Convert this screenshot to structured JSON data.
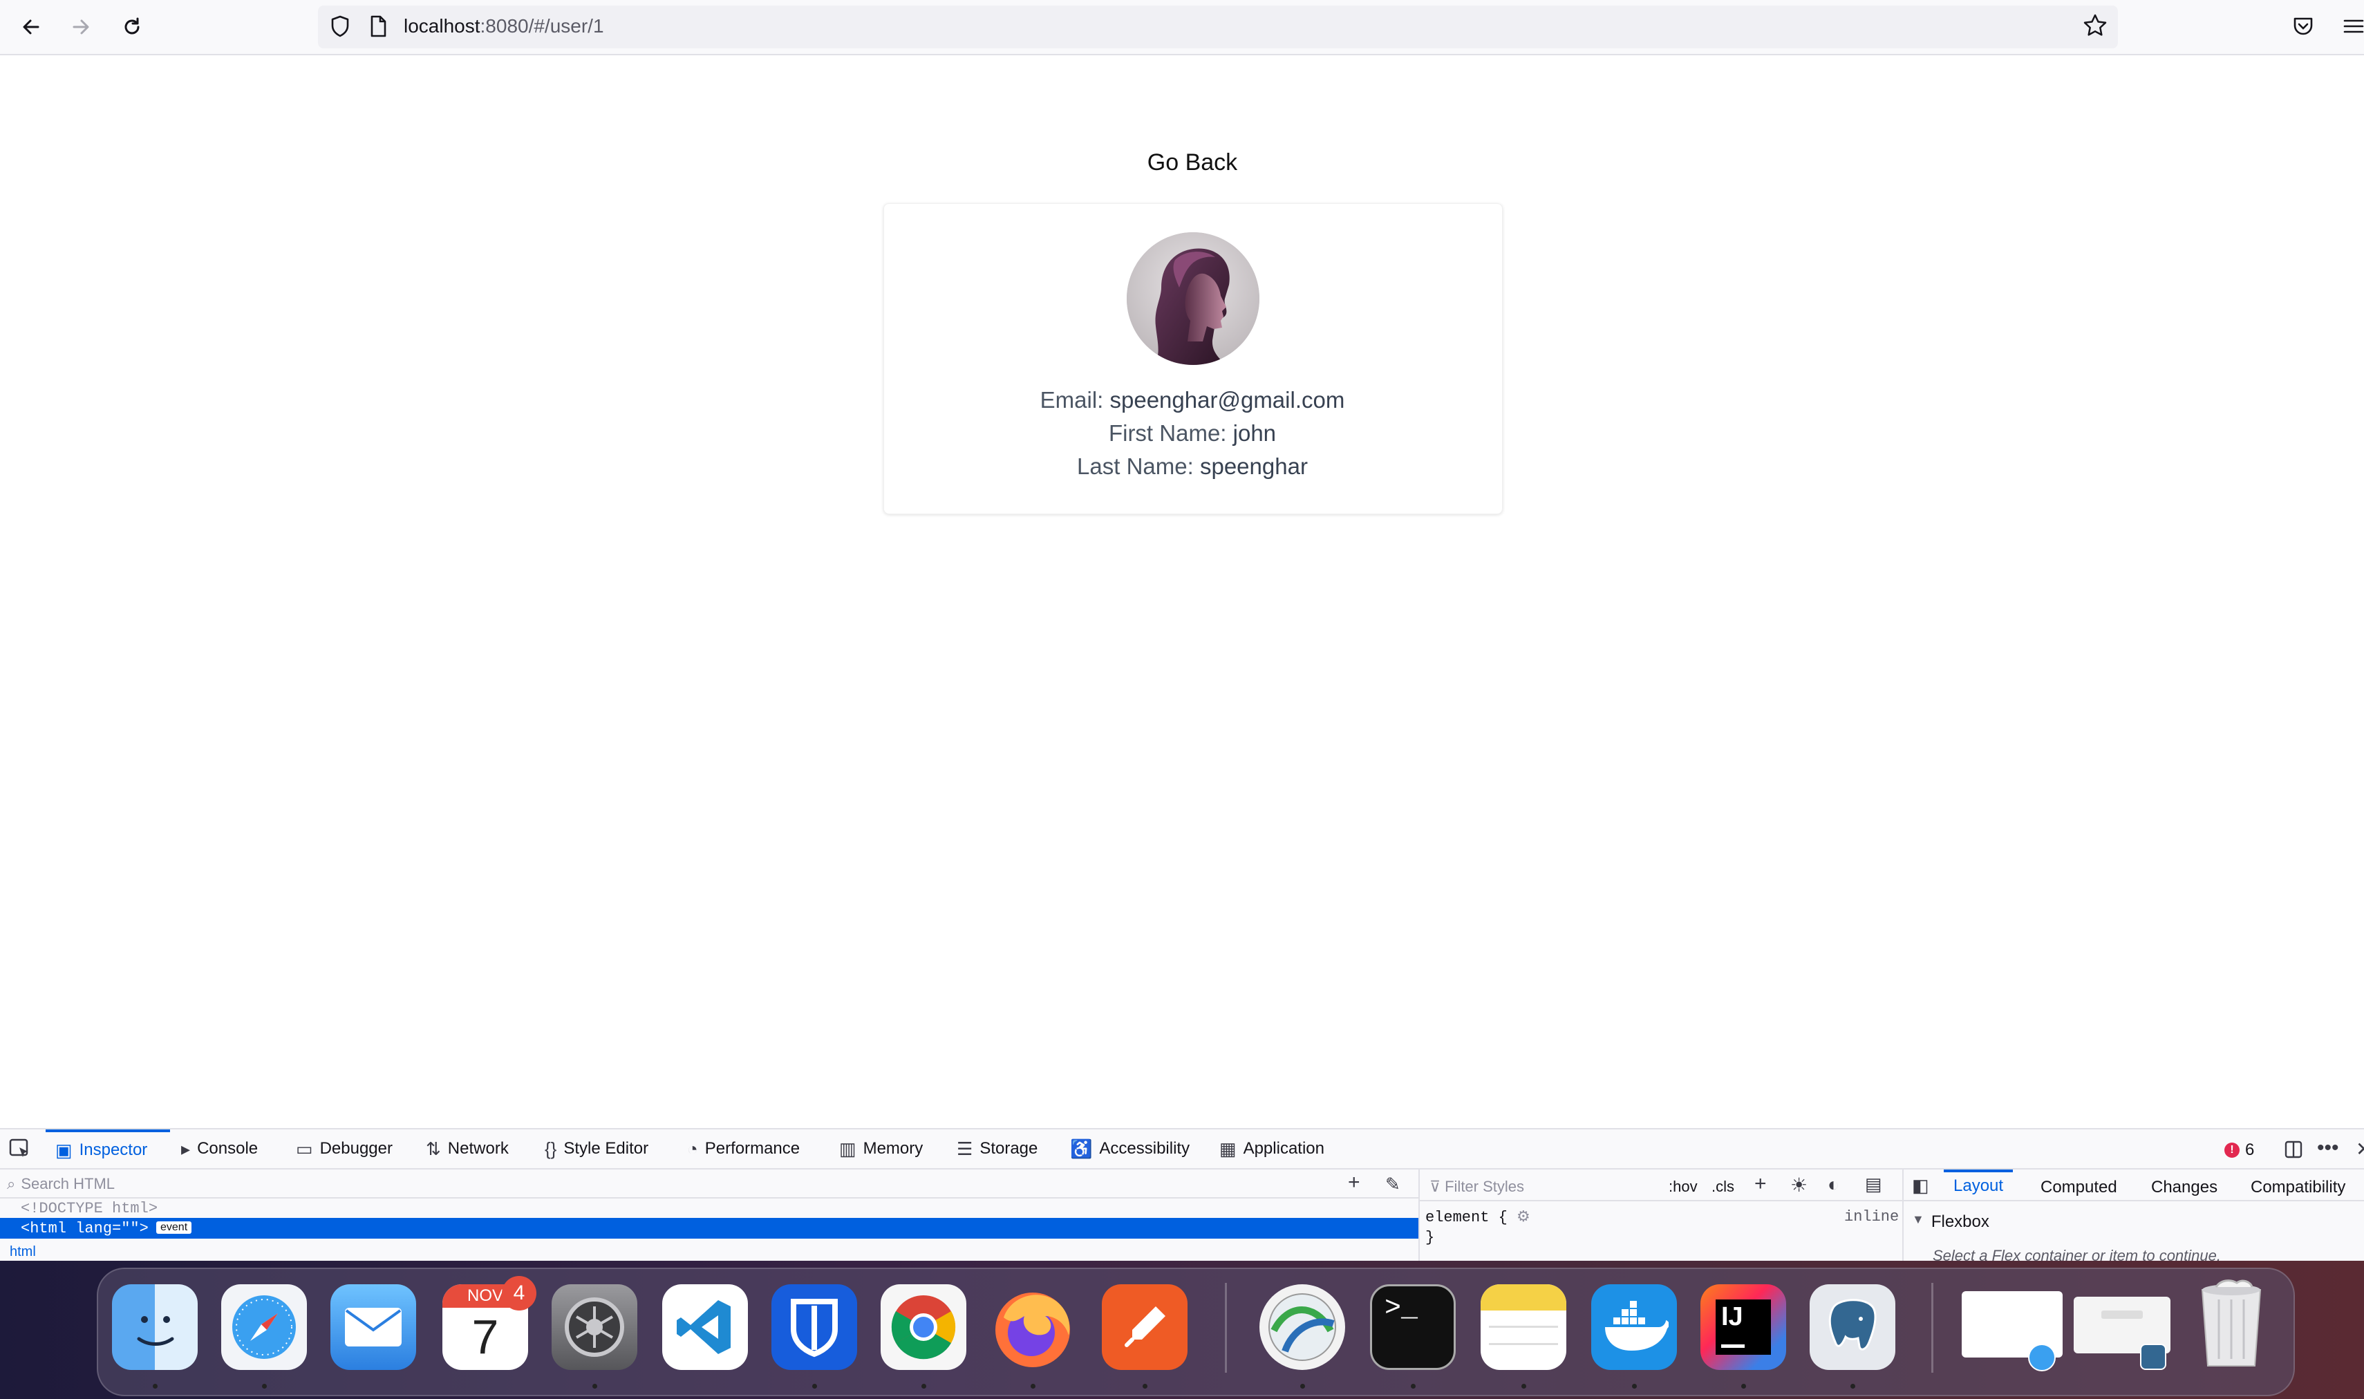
{
  "browser": {
    "url_host": "localhost",
    "url_rest": ":8080/#/user/1"
  },
  "page": {
    "go_back_label": "Go Back",
    "email_label": "Email:",
    "email_value": "speenghar@gmail.com",
    "first_name_label": "First Name:",
    "first_name_value": "john",
    "last_name_label": "Last Name:",
    "last_name_value": "speenghar"
  },
  "devtools": {
    "tabs": [
      "Inspector",
      "Console",
      "Debugger",
      "Network",
      "Style Editor",
      "Performance",
      "Memory",
      "Storage",
      "Accessibility",
      "Application"
    ],
    "error_count": "6",
    "search_placeholder": "Search HTML",
    "doctype_line": "<!DOCTYPE html>",
    "selected_line": "<html lang=\"\">",
    "event_badge": "event",
    "breadcrumb": "html",
    "filter_styles_placeholder": "Filter Styles",
    "hov": ":hov",
    "cls": ".cls",
    "rule_selector": "element {",
    "rule_close": "}",
    "rule_source": "inline",
    "side_tabs": [
      "Layout",
      "Computed",
      "Changes",
      "Compatibility"
    ],
    "flexbox_heading": "Flexbox",
    "flexbox_hint": "Select a Flex container or item to continue."
  },
  "dock": {
    "calendar_month": "NOV",
    "calendar_day": "7",
    "calendar_badge": "4"
  }
}
